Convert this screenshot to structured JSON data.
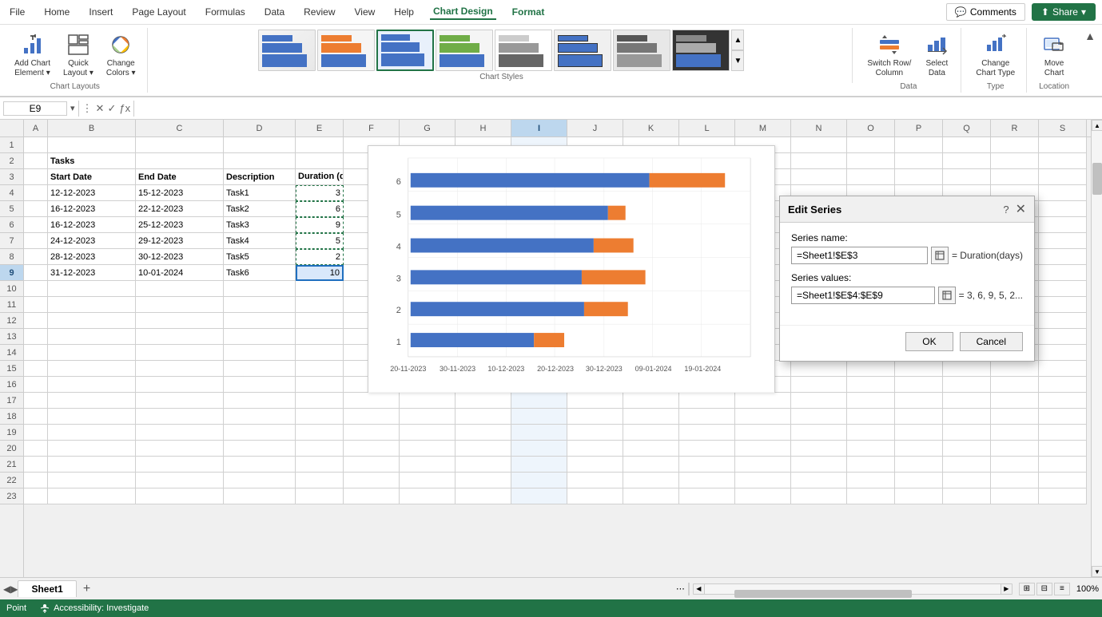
{
  "menu": {
    "items": [
      "File",
      "Home",
      "Insert",
      "Page Layout",
      "Formulas",
      "Data",
      "Review",
      "View",
      "Help",
      "Chart Design",
      "Format"
    ],
    "active": [
      "Chart Design",
      "Format"
    ]
  },
  "toolbar": {
    "groups": [
      {
        "label": "Chart Layouts",
        "items": [
          {
            "id": "add-chart-element",
            "label": "Add Chart\nElement"
          },
          {
            "id": "quick-layout",
            "label": "Quick\nLayout"
          },
          {
            "id": "change-colors",
            "label": "Change\nColors"
          }
        ]
      },
      {
        "label": "Chart Styles",
        "styles": 8
      },
      {
        "label": "Data",
        "items": [
          {
            "id": "switch-row-col",
            "label": "Switch Row/\nColumn"
          },
          {
            "id": "select-data",
            "label": "Select\nData"
          }
        ]
      },
      {
        "label": "Type",
        "items": [
          {
            "id": "change-chart-type",
            "label": "Change\nChart Type"
          }
        ]
      },
      {
        "label": "Location",
        "items": [
          {
            "id": "move-chart",
            "label": "Move\nChart"
          }
        ]
      }
    ]
  },
  "formula_bar": {
    "cell_ref": "E9",
    "formula": ""
  },
  "columns": [
    "A",
    "B",
    "C",
    "D",
    "E",
    "F",
    "G",
    "H",
    "I",
    "J",
    "K",
    "L",
    "M",
    "N",
    "O",
    "P",
    "Q",
    "R",
    "S"
  ],
  "rows": [
    1,
    2,
    3,
    4,
    5,
    6,
    7,
    8,
    9,
    10,
    11,
    12,
    13,
    14,
    15,
    16,
    17,
    18,
    19,
    20,
    21,
    22,
    23
  ],
  "cells": {
    "B2": "Tasks",
    "B3": "Start Date",
    "C3": "End Date",
    "D3": "Description",
    "E3": "Duration\n(days)",
    "B4": "12-12-2023",
    "C4": "15-12-2023",
    "D4": "Task1",
    "E4": "3",
    "B5": "16-12-2023",
    "C5": "22-12-2023",
    "D5": "Task2",
    "E5": "6",
    "B6": "16-12-2023",
    "C6": "25-12-2023",
    "D6": "Task3",
    "E6": "9",
    "B7": "24-12-2023",
    "C7": "29-12-2023",
    "D7": "Task4",
    "E7": "5",
    "B8": "28-12-2023",
    "C8": "30-12-2023",
    "D8": "Task5",
    "E8": "2",
    "B9": "31-12-2023",
    "C9": "10-01-2024",
    "D9": "Task6",
    "E9": "10"
  },
  "dialog": {
    "title": "Edit Series",
    "series_name_label": "Series name:",
    "series_name_value": "=Sheet1!$E$3",
    "series_name_eq": "= Duration(days)",
    "series_values_label": "Series values:",
    "series_values_value": "=Sheet1!$E$4:$E$9",
    "series_values_eq": "= 3, 6, 9, 5, 2...",
    "ok_label": "OK",
    "cancel_label": "Cancel",
    "help_icon": "?",
    "close_icon": "✕"
  },
  "chart": {
    "x_labels": [
      "20-11-2023",
      "30-11-2023",
      "10-12-2023",
      "20-12-2023",
      "30-12-2023",
      "09-01-2024",
      "19-01-2024"
    ],
    "y_labels": [
      1,
      2,
      3,
      4,
      5,
      6
    ],
    "bars": [
      {
        "y": 1,
        "blue_start": 10,
        "blue_width": 55,
        "orange_start": 65,
        "orange_width": 22
      },
      {
        "y": 2,
        "blue_start": 10,
        "blue_width": 155,
        "orange_start": 165,
        "orange_width": 40
      },
      {
        "y": 3,
        "blue_start": 10,
        "blue_width": 172,
        "orange_start": 182,
        "orange_width": 60
      },
      {
        "y": 4,
        "blue_start": 10,
        "blue_width": 200,
        "orange_start": 210,
        "orange_width": 52
      },
      {
        "y": 5,
        "blue_start": 10,
        "blue_width": 250,
        "orange_start": 260,
        "orange_width": 45
      },
      {
        "y": 6,
        "blue_start": 10,
        "blue_width": 310,
        "orange_start": 320,
        "orange_width": 80
      }
    ]
  },
  "sheet_tab": "Sheet1",
  "add_sheet_icon": "+",
  "status": {
    "mode": "Point",
    "accessibility": "Accessibility: Investigate",
    "zoom": "100%"
  },
  "buttons": {
    "comments": "Comments",
    "share": "Share"
  },
  "nav": {
    "prev": "◀",
    "next": "▶"
  }
}
